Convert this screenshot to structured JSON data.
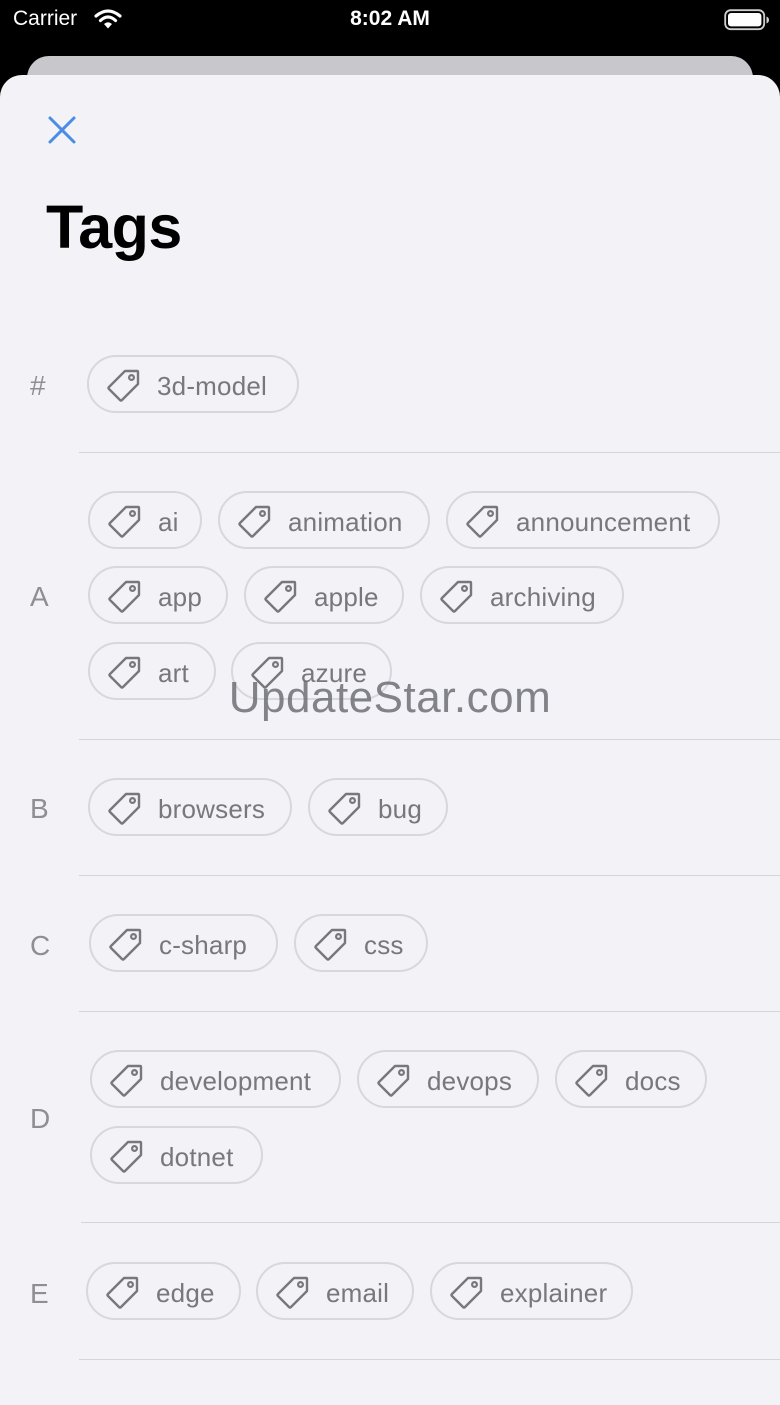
{
  "status_bar": {
    "carrier": "Carrier",
    "time": "8:02 AM"
  },
  "colors": {
    "accent": "#4a8ce6",
    "chip_border": "#d7d7dc",
    "chip_text": "#78787c",
    "section_letter": "#8e8e93",
    "background": "#f2f2f7"
  },
  "icons": {
    "close": "close-icon",
    "tag": "tag-icon",
    "wifi": "wifi-icon",
    "battery": "battery-icon"
  },
  "header": {
    "title": "Tags"
  },
  "sections": [
    {
      "letter": "#",
      "tags": [
        "3d-model"
      ]
    },
    {
      "letter": "A",
      "tags": [
        "ai",
        "animation",
        "announcement",
        "app",
        "apple",
        "archiving",
        "art",
        "azure"
      ]
    },
    {
      "letter": "B",
      "tags": [
        "browsers",
        "bug"
      ]
    },
    {
      "letter": "C",
      "tags": [
        "c-sharp",
        "css"
      ]
    },
    {
      "letter": "D",
      "tags": [
        "development",
        "devops",
        "docs",
        "dotnet"
      ]
    },
    {
      "letter": "E",
      "tags": [
        "edge",
        "email",
        "explainer"
      ]
    }
  ],
  "watermark": "UpdateStar.com"
}
